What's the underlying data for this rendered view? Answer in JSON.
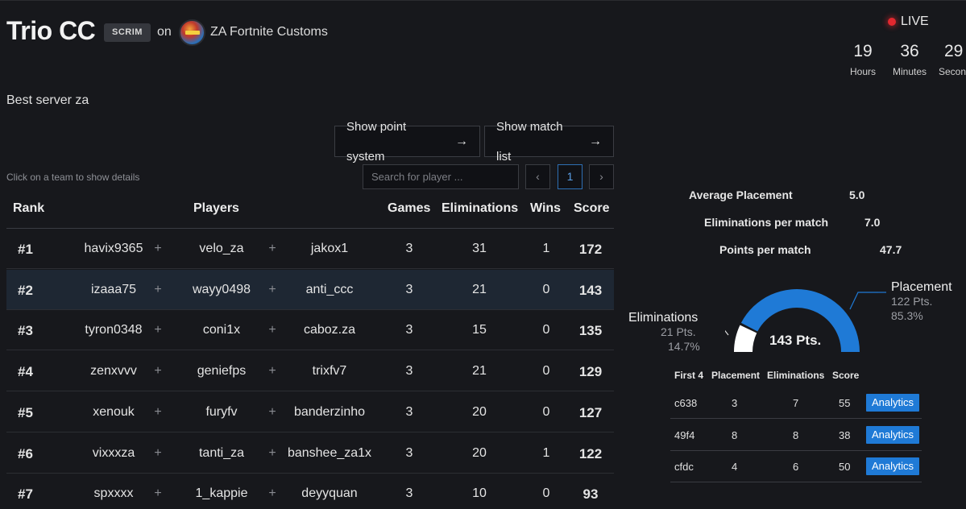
{
  "header": {
    "title": "Trio CC",
    "badge": "SCRIM",
    "on_text": "on",
    "org_name": "ZA Fortnite Customs",
    "live_label": "LIVE",
    "countdown": [
      {
        "value": "19",
        "label": "Hours"
      },
      {
        "value": "36",
        "label": "Minutes"
      },
      {
        "value": "29",
        "label": "Seconds"
      }
    ]
  },
  "description": "Best server za",
  "buttons": {
    "point_system": "Show point system",
    "match_list": "Show match list"
  },
  "table_controls": {
    "hint": "Click on a team to show details",
    "search_placeholder": "Search for player ...",
    "current_page": "1",
    "prev": "‹",
    "next": "›"
  },
  "table": {
    "headers": {
      "rank": "Rank",
      "players": "Players",
      "games": "Games",
      "eliminations": "Eliminations",
      "wins": "Wins",
      "score": "Score"
    },
    "rows": [
      {
        "rank": "#1",
        "p1": "havix9365",
        "p2": "velo_za",
        "p3": "jakox1",
        "games": "3",
        "elims": "31",
        "wins": "1",
        "score": "172"
      },
      {
        "rank": "#2",
        "p1": "izaaa75",
        "p2": "wayy0498",
        "p3": "anti_ccc",
        "games": "3",
        "elims": "21",
        "wins": "0",
        "score": "143"
      },
      {
        "rank": "#3",
        "p1": "tyron0348",
        "p2": "coni1x",
        "p3": "caboz.za",
        "games": "3",
        "elims": "15",
        "wins": "0",
        "score": "135"
      },
      {
        "rank": "#4",
        "p1": "zenxvvv",
        "p2": "geniefps",
        "p3": "trixfv7",
        "games": "3",
        "elims": "21",
        "wins": "0",
        "score": "129"
      },
      {
        "rank": "#5",
        "p1": "xenouk",
        "p2": "furyfv",
        "p3": "banderzinho",
        "games": "3",
        "elims": "20",
        "wins": "0",
        "score": "127"
      },
      {
        "rank": "#6",
        "p1": "vixxxza",
        "p2": "tanti_za",
        "p3": "banshee_za1x",
        "games": "3",
        "elims": "20",
        "wins": "1",
        "score": "122"
      },
      {
        "rank": "#7",
        "p1": "spxxxx",
        "p2": "1_kappie",
        "p3": "deyyquan",
        "games": "3",
        "elims": "10",
        "wins": "0",
        "score": "93"
      }
    ],
    "plus": "+"
  },
  "details": {
    "stats": [
      {
        "label": "Average Placement",
        "value": "5.0"
      },
      {
        "label": "Eliminations per match",
        "value": "7.0"
      },
      {
        "label": "Points per match",
        "value": "47.7"
      }
    ],
    "gauge": {
      "total": "143 Pts.",
      "eliminations": {
        "label": "Eliminations",
        "pts": "21 Pts.",
        "pct": "14.7%",
        "fraction": 0.147
      },
      "placement": {
        "label": "Placement",
        "pts": "122 Pts.",
        "pct": "85.3%",
        "fraction": 0.853
      },
      "colors": {
        "placement": "#1f7ad6",
        "eliminations": "#ffffff"
      }
    },
    "matches": {
      "headers": {
        "id": "First 4",
        "placement": "Placement",
        "eliminations": "Eliminations",
        "score": "Score"
      },
      "rows": [
        {
          "id": "c638",
          "placement": "3",
          "eliminations": "7",
          "score": "55",
          "action": "Analytics"
        },
        {
          "id": "49f4",
          "placement": "8",
          "eliminations": "8",
          "score": "38",
          "action": "Analytics"
        },
        {
          "id": "cfdc",
          "placement": "4",
          "eliminations": "6",
          "score": "50",
          "action": "Analytics"
        }
      ]
    }
  }
}
